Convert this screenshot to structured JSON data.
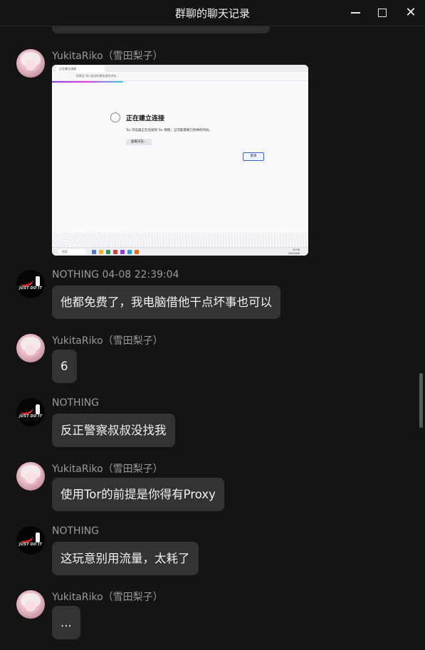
{
  "window": {
    "title": "群聊的聊天记录"
  },
  "messages": [
    {
      "sender": "YukitaRiko（雪田梨子）",
      "type": "image",
      "image": {
        "tab_label": "正在建立连接",
        "url_text": "探索由 Tor 驱动的更私密的浏览...",
        "heading": "正在建立连接",
        "description": "Tor 浏览器正在连接到 Tor 网络，这可能需要几秒钟的时间。",
        "log_button": "查看日志...",
        "cancel_button": "取消",
        "taskbar_search": "搜索",
        "clock_time": "22:38",
        "clock_date": "2023/4/8"
      }
    },
    {
      "sender": "NOTHING 04-08 22:39:04",
      "text": "他都免费了，我电脑借他干点坏事也可以"
    },
    {
      "sender": "YukitaRiko（雪田梨子）",
      "text": "6"
    },
    {
      "sender": "NOTHING",
      "text": "反正警察叔叔没找我"
    },
    {
      "sender": "YukitaRiko（雪田梨子）",
      "text": "使用Tor的前提是你得有Proxy"
    },
    {
      "sender": "NOTHING",
      "text": "这玩意别用流量，太耗了"
    },
    {
      "sender": "YukitaRiko（雪田梨子）",
      "text": "..."
    }
  ],
  "avatars": {
    "yukita": "anime-girl-avatar",
    "nothing": "just-do-it-avatar",
    "nothing_slogan": "JUST DO IT"
  },
  "colors": {
    "background": "#141414",
    "bubble": "#333333",
    "name": "#9a9a9a"
  }
}
